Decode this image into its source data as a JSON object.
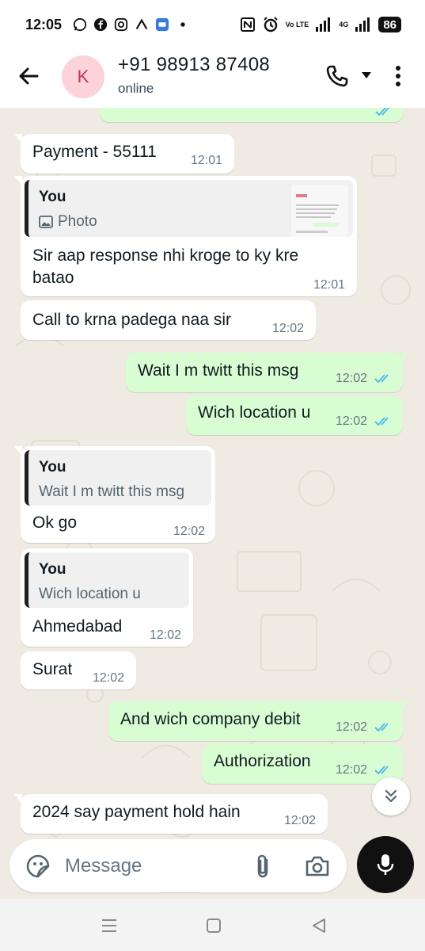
{
  "status_bar": {
    "time": "12:05",
    "network_label": "Vo LTE",
    "network2_label": "4G",
    "battery": "86"
  },
  "header": {
    "avatar_letter": "K",
    "contact_name": "+91 98913 87408",
    "contact_status": "online"
  },
  "messages": [
    {
      "direction": "in",
      "text": "Payment - 55111",
      "time": "12:01"
    },
    {
      "direction": "in",
      "quote_author": "You",
      "quote_body": "Photo",
      "text_line1": "Sir aap response nhi kroge to ky kre",
      "text_line2": "batao",
      "time": "12:01"
    },
    {
      "direction": "in",
      "text": "Call to krna padega naa sir",
      "time": "12:02"
    },
    {
      "direction": "out",
      "text": "Wait I m twitt this msg",
      "time": "12:02",
      "status": "read"
    },
    {
      "direction": "out",
      "text": "Wich location u",
      "time": "12:02",
      "status": "read"
    },
    {
      "direction": "in",
      "quote_author": "You",
      "quote_body": "Wait I m twitt this msg",
      "text": "Ok go",
      "time": "12:02"
    },
    {
      "direction": "in",
      "quote_author": "You",
      "quote_body": "Wich location u",
      "text": "Ahmedabad",
      "time": "12:02"
    },
    {
      "direction": "in",
      "text": "Surat",
      "time": "12:02"
    },
    {
      "direction": "out",
      "text": "And wich company debit",
      "time": "12:02",
      "status": "read"
    },
    {
      "direction": "out",
      "text": "Authorization",
      "time": "12:02",
      "status": "read"
    },
    {
      "direction": "in",
      "text": "2024 say payment hold hain",
      "time": "12:02"
    }
  ],
  "composer": {
    "placeholder": "Message"
  },
  "colors": {
    "chat_background": "#efeae2",
    "outgoing_bubble": "#d9fdd3",
    "incoming_bubble": "#ffffff",
    "read_ticks": "#53bdeb",
    "avatar_bg": "#fbd3d9",
    "avatar_text": "#c0355a"
  },
  "icons": [
    "back-arrow-icon",
    "phone-icon",
    "dropdown-icon",
    "more-vert-icon",
    "photo-icon",
    "double-check-icon",
    "scroll-down-icon",
    "sticker-icon",
    "attach-icon",
    "camera-icon",
    "mic-icon",
    "nav-recents-icon",
    "nav-home-icon",
    "nav-back-icon"
  ]
}
